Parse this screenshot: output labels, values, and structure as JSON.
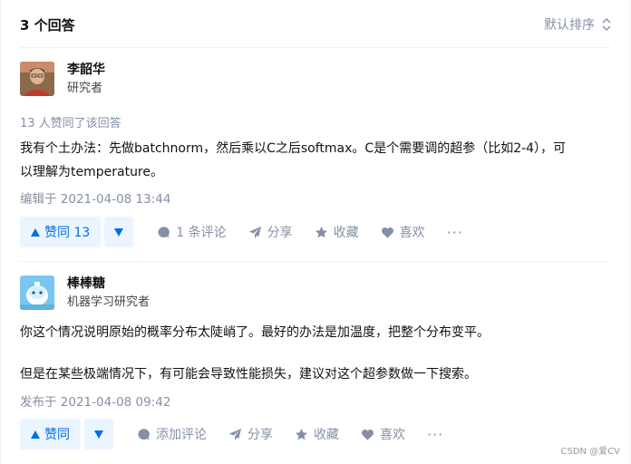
{
  "header": {
    "count_label": "3 个回答",
    "sort_label": "默认排序"
  },
  "answers": [
    {
      "author_name": "李韶华",
      "author_headline": "研究者",
      "voters_text": "13 人赞同了该回答",
      "content_lines": [
        "我有个土办法：先做batchnorm，然后乘以C之后softmax。C是个需要调的超参（比如2-4），可",
        "以理解为temperature。"
      ],
      "time_text": "编辑于 2021-04-08 13:44",
      "vote_label": "赞同 13",
      "comment_label": "1 条评论",
      "share_label": "分享",
      "collect_label": "收藏",
      "like_label": "喜欢"
    },
    {
      "author_name": "棒棒糖",
      "author_headline": "机器学习研究者",
      "content_lines": [
        "你这个情况说明原始的概率分布太陡峭了。最好的办法是加温度，把整个分布变平。",
        "但是在某些极端情况下，有可能会导致性能损失，建议对这个超参数做一下搜索。"
      ],
      "time_text": "发布于 2021-04-08 09:42",
      "vote_label": "赞同",
      "comment_label": "添加评论",
      "share_label": "分享",
      "collect_label": "收藏",
      "like_label": "喜欢"
    }
  ],
  "watermark": "CSDN @爱CV",
  "colors": {
    "accent": "#056de8",
    "accent_bg": "#ebf5ff",
    "muted": "#8590a6"
  }
}
